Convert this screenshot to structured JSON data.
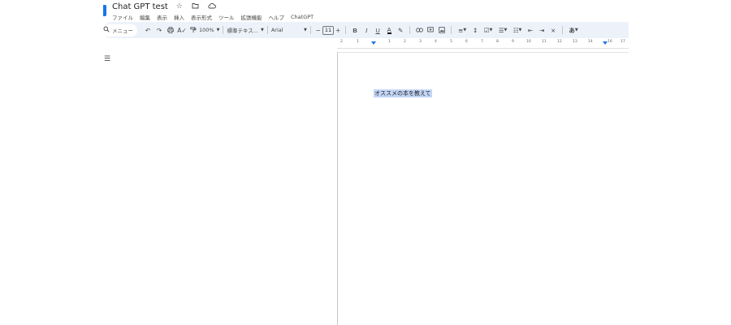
{
  "header": {
    "title": "Chat GPT test",
    "icons": [
      "star-icon",
      "move-to-folder-icon",
      "cloud-status-icon"
    ],
    "menu": [
      "ファイル",
      "編集",
      "表示",
      "挿入",
      "表示形式",
      "ツール",
      "拡張機能",
      "ヘルプ",
      "ChatGPT"
    ]
  },
  "toolbar": {
    "search_label": "メニュー",
    "zoom": "100%",
    "style": "標準テキス...",
    "font": "Arial",
    "font_size": "11",
    "minus": "−",
    "plus": "+",
    "bold": "B",
    "italic": "I",
    "underline": "U",
    "text_color": "A",
    "translate": "あ"
  },
  "ruler": {
    "ticks": [
      "2",
      "1",
      "1",
      "2",
      "3",
      "4",
      "5",
      "6",
      "7",
      "8",
      "9",
      "10",
      "11",
      "12",
      "13",
      "14",
      "15",
      "16",
      "17"
    ]
  },
  "document": {
    "text": "オススメの本を教えて"
  },
  "colors": {
    "toolbar_bg": "#edf2fa",
    "accent": "#1a73e8",
    "selection": "#c3d6f7"
  }
}
